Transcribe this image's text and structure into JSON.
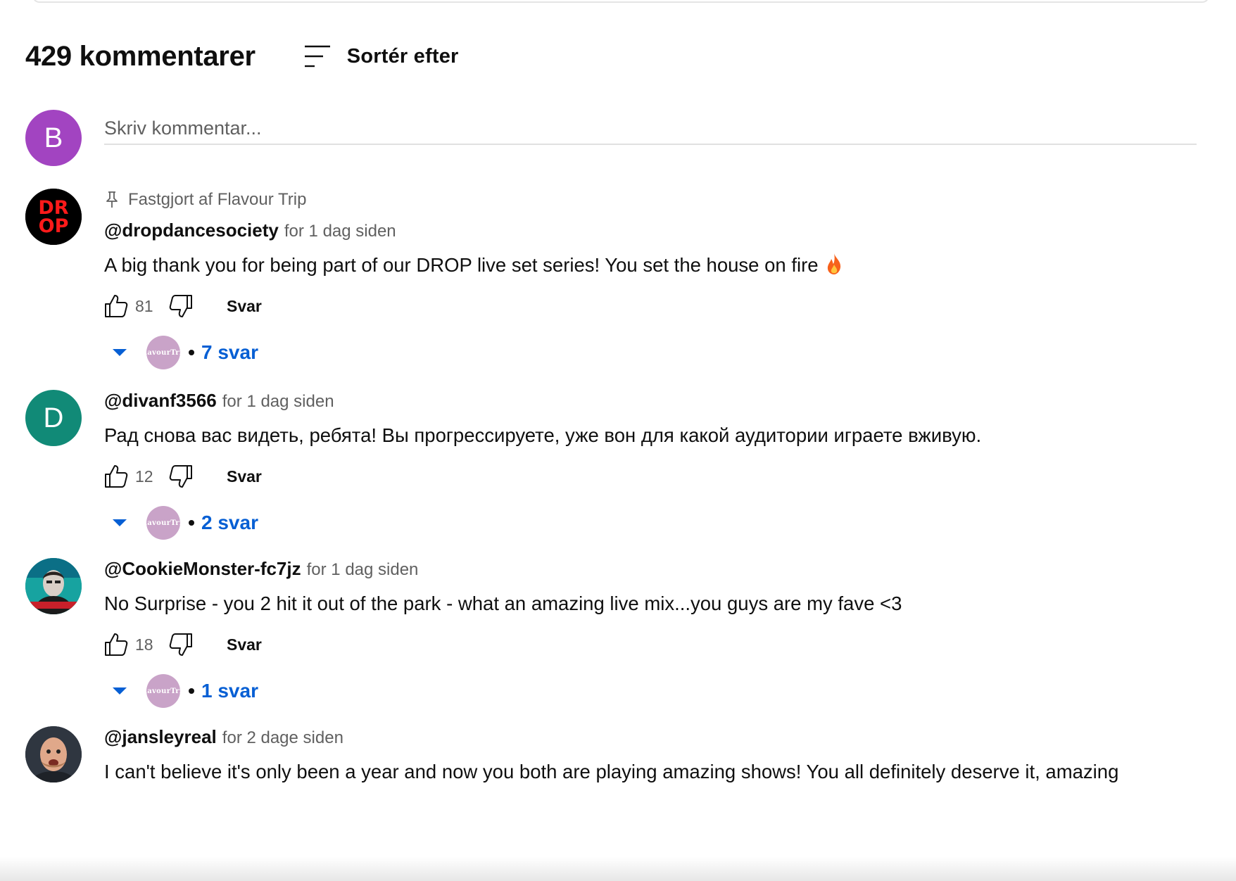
{
  "header": {
    "count_label": "429 kommentarer",
    "sort_label": "Sortér efter"
  },
  "composer": {
    "avatar_letter": "B",
    "avatar_color": "#a244c1",
    "placeholder": "Skriv kommentar..."
  },
  "comments": [
    {
      "pinned_label": "Fastgjort af Flavour Trip",
      "author": "@dropdancesociety",
      "time": "for 1 dag siden",
      "text": "A big thank you for being part of our DROP live set series! You set the house on fire",
      "emoji": "fire",
      "likes": "81",
      "reply_label": "Svar",
      "replies_label": "7 svar",
      "avatar_text": [
        "DR",
        "OP"
      ]
    },
    {
      "author": "@divanf3566",
      "time": "for 1 dag siden",
      "text": "Рад снова вас видеть, ребята! Вы прогрессируете, уже вон для какой аудитории играете вживую.",
      "likes": "12",
      "reply_label": "Svar",
      "replies_label": "2 svar",
      "avatar_letter": "D",
      "avatar_color": "#118a77"
    },
    {
      "author": "@CookieMonster-fc7jz",
      "time": "for 1 dag siden",
      "text": "No Surprise - you 2 hit it out of the park - what an amazing live mix...you guys are my fave <3",
      "likes": "18",
      "reply_label": "Svar",
      "replies_label": "1 svar"
    },
    {
      "author": "@jansleyreal",
      "time": "for 2 dage siden",
      "text": "I can't believe it's only been a year and now you both are playing amazing shows! You all definitely deserve it, amazing"
    }
  ],
  "reply_avatar_text": [
    "Flavour",
    "Trip"
  ],
  "colors": {
    "link_blue": "#065fd4",
    "secondary_text": "#606060",
    "primary_text": "#0f0f0f"
  }
}
